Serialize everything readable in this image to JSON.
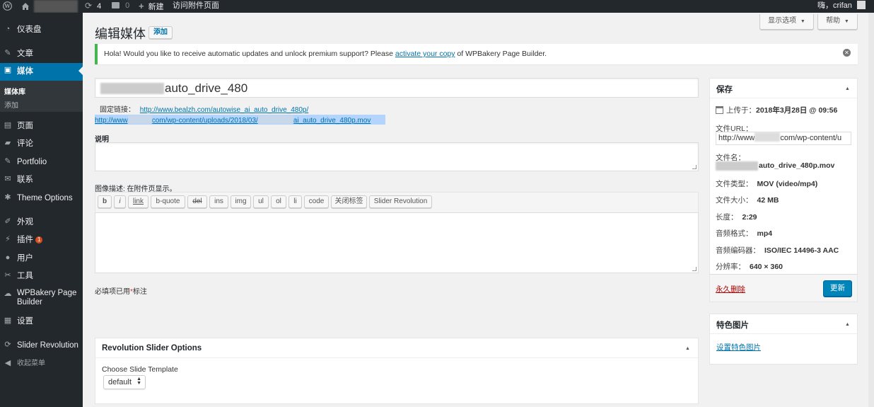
{
  "adminbar": {
    "updates_count": "4",
    "comments_count": "0",
    "new_label": "新建",
    "view_attachment": "访问附件页面",
    "greeting": "嗨，crifan"
  },
  "sidebar": {
    "items": [
      {
        "label": "仪表盘",
        "icon": "dashboard-icon"
      },
      {
        "label": "文章",
        "icon": "pin-icon"
      },
      {
        "label": "媒体",
        "icon": "media-icon"
      },
      {
        "label": "页面",
        "icon": "page-icon"
      },
      {
        "label": "评论",
        "icon": "comment-icon"
      },
      {
        "label": "Portfolio",
        "icon": "pin-icon"
      },
      {
        "label": "联系",
        "icon": "mail-icon"
      },
      {
        "label": "Theme Options",
        "icon": "gear-icon"
      },
      {
        "label": "外观",
        "icon": "brush-icon"
      },
      {
        "label": "插件",
        "icon": "plugin-icon",
        "badge": "1"
      },
      {
        "label": "用户",
        "icon": "user-icon"
      },
      {
        "label": "工具",
        "icon": "wrench-icon"
      },
      {
        "label": "WPBakery Page Builder",
        "icon": "cloud-icon"
      },
      {
        "label": "设置",
        "icon": "settings-icon"
      },
      {
        "label": "Slider Revolution",
        "icon": "refresh-icon"
      },
      {
        "label": "收起菜单",
        "icon": "collapse-icon"
      }
    ],
    "submenu": [
      "媒体库",
      "添加"
    ]
  },
  "screen_options": "显示选项",
  "help": "帮助",
  "page_title": "编辑媒体",
  "add_button": "添加",
  "notice": {
    "before": "Hola! Would you like to receive automatic updates and unlock premium support? Please ",
    "link": "activate your copy",
    "after": " of WPBakery Page Builder."
  },
  "title_value": "auto_drive_480",
  "permalink": {
    "label": "固定链接：",
    "url": "http://www.bealzh.com/autowise_ai_auto_drive_480p/"
  },
  "file_url_line": {
    "part1": "http://www",
    "part2": "com/wp-content/uploads/2018/03/",
    "part3": "ai_auto_drive_480p.mov"
  },
  "caption_label": "说明",
  "description_label": "图像描述: 在附件页显示。",
  "quicktags": [
    "b",
    "i",
    "link",
    "b-quote",
    "del",
    "ins",
    "img",
    "ul",
    "ol",
    "li",
    "code",
    "关闭标签",
    "Slider Revolution"
  ],
  "required_note": {
    "before": "必填项已用",
    "star": "*",
    "after": "标注"
  },
  "rev_slider": {
    "title": "Revolution Slider Options",
    "template_label": "Choose Slide Template",
    "template_value": "default"
  },
  "save_box": {
    "title": "保存",
    "uploaded_label": "上传于：",
    "uploaded_value": "2018年3月28日 @ 09:56",
    "file_url_label": "文件URL：",
    "file_url_part1": "http://www",
    "file_url_part2": "com/wp-content/u",
    "file_name_label": "文件名：",
    "file_name_value": "auto_drive_480p.mov",
    "file_type_label": "文件类型：",
    "file_type_value": "MOV (video/mp4)",
    "file_size_label": "文件大小：",
    "file_size_value": "42 MB",
    "length_label": "长度：",
    "length_value": "2:29",
    "audio_format_label": "音频格式：",
    "audio_format_value": "mp4",
    "audio_codec_label": "音频编码器：",
    "audio_codec_value": "ISO/IEC 14496-3 AAC",
    "resolution_label": "分辨率：",
    "resolution_value": "640 × 360",
    "delete_label": "永久删除",
    "update_label": "更新"
  },
  "featured_box": {
    "title": "特色图片",
    "set_link": "设置特色图片"
  }
}
